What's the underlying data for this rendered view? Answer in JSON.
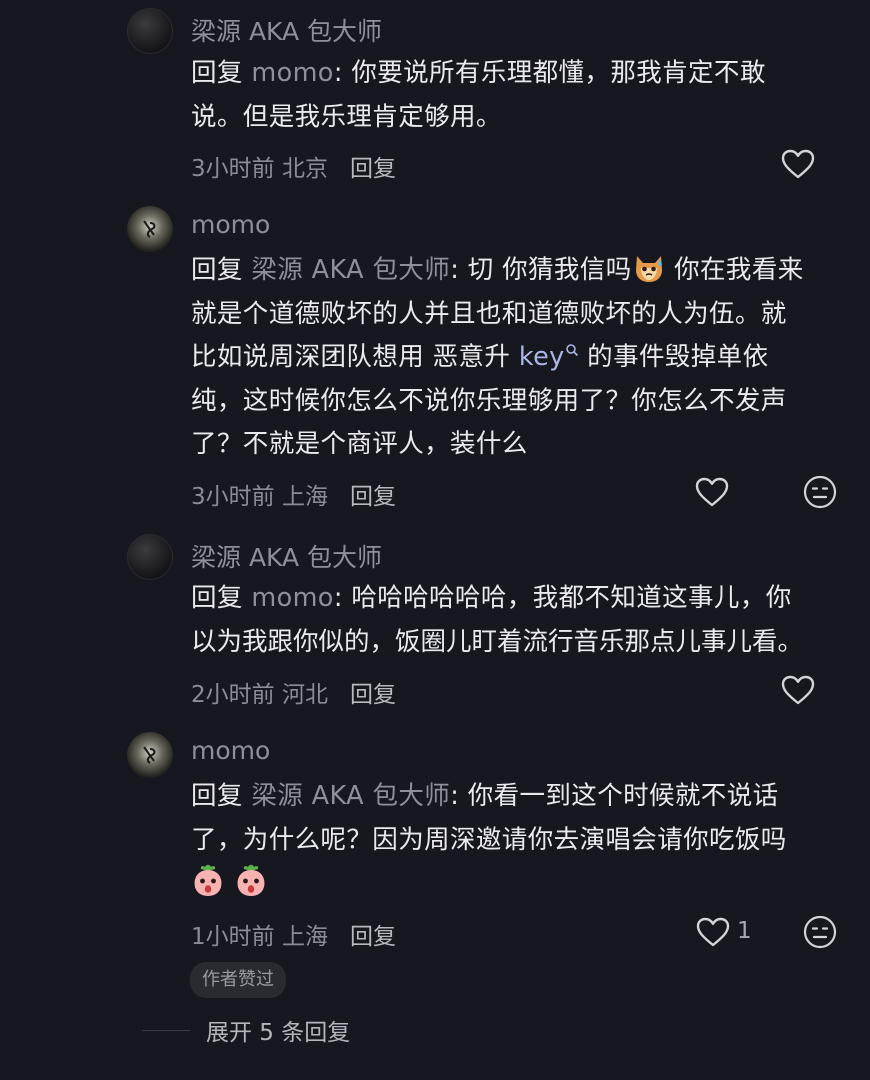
{
  "comments": [
    {
      "username": "梁源 AKA 包大师",
      "reply_word": "回复",
      "reply_target": "momo",
      "text_lines": [
        "你要说所有乐理都懂，那我肯定不敢",
        "说。但是我乐理肯定够用。"
      ],
      "time": "3小时前",
      "location": "北京",
      "reply_label": "回复"
    },
    {
      "username": "momo",
      "reply_word": "回复",
      "reply_target": "梁源 AKA 包大师",
      "line1_a": "切 你猜我信吗",
      "emoji1": "cat-sweat-emoji",
      "line1_b": " 你在我看来",
      "line2": "就是个道德败坏的人并且也和道德败坏的人为伍。就",
      "line3_a": "比如说周深团队想用 恶意升",
      "line3_key": "key",
      "line3_b": " 的事件毁掉单依",
      "line4": "纯，这时候你怎么不说你乐理够用了？你怎么不发声",
      "line5": "了？不就是个商评人，装什么",
      "time": "3小时前",
      "location": "上海",
      "reply_label": "回复"
    },
    {
      "username": "梁源 AKA 包大师",
      "reply_word": "回复",
      "reply_target": "momo",
      "text_lines": [
        "哈哈哈哈哈哈，我都不知道这事儿，你",
        "以为我跟你似的，饭圈儿盯着流行音乐那点儿事儿看。"
      ],
      "time": "2小时前",
      "location": "河北",
      "reply_label": "回复"
    },
    {
      "username": "momo",
      "reply_word": "回复",
      "reply_target": "梁源 AKA 包大师",
      "text_lines": [
        "你看一到这个时候就不说话",
        "了，为什么呢？因为周深邀请你去演唱会请你吃饭吗"
      ],
      "emoji_line": [
        "peach-shock-emoji",
        "peach-shock-emoji"
      ],
      "time": "1小时前",
      "location": "上海",
      "reply_label": "回复",
      "like_count": "1",
      "author_badge": "作者赞过"
    }
  ],
  "expand_label": "展开 5 条回复",
  "colors": {
    "background": "#171720",
    "text": "#eaeaee",
    "muted": "#8f8f98",
    "link": "#a9b7e6"
  }
}
